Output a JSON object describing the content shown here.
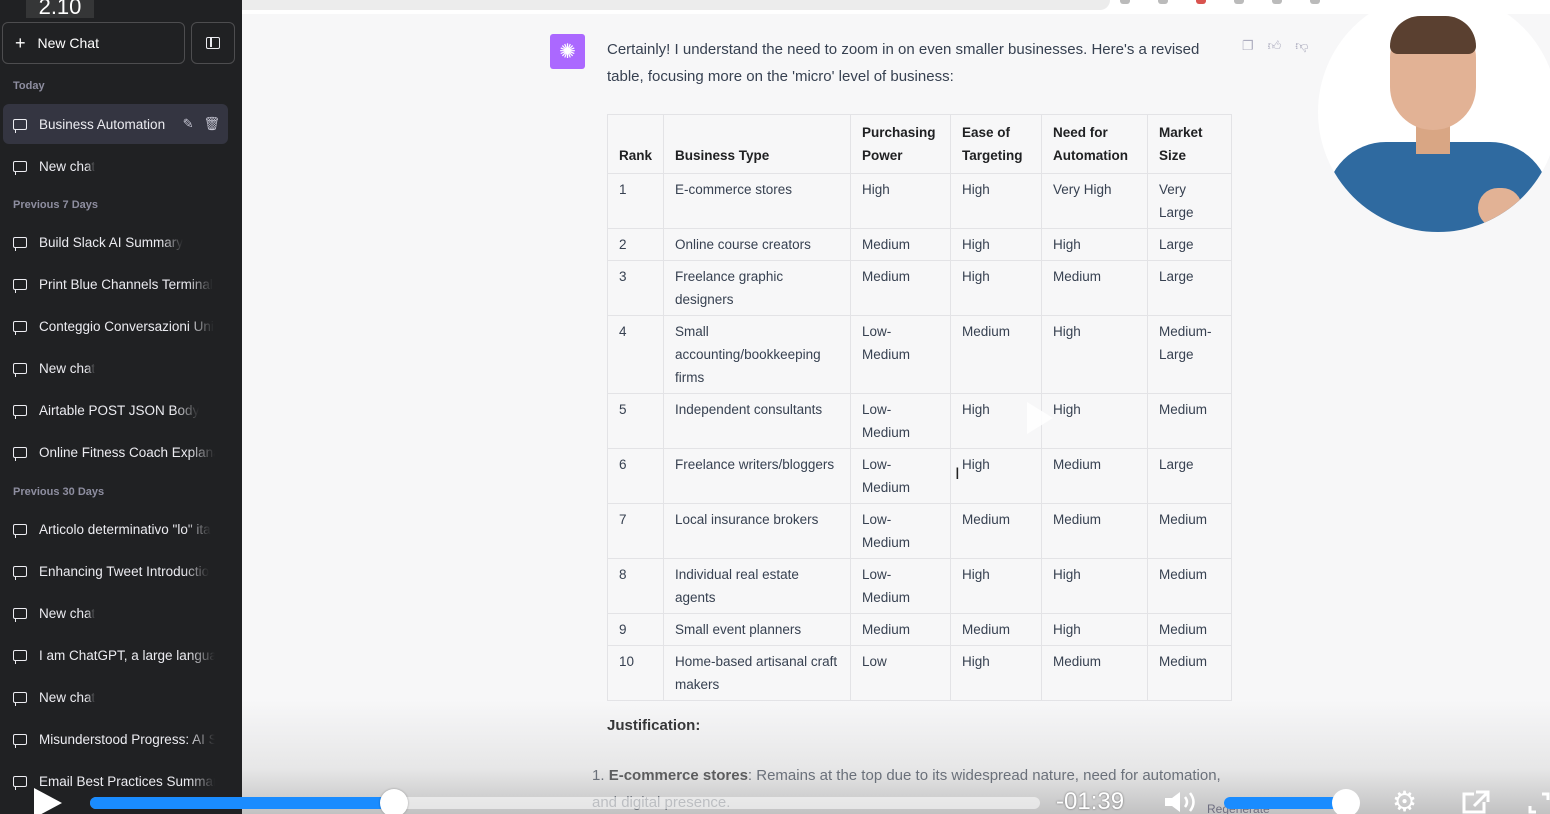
{
  "overlay": {
    "playback_speed": "2.10"
  },
  "sidebar": {
    "new_chat_label": "New Chat",
    "sections": {
      "today": "Today",
      "prev7": "Previous 7 Days",
      "prev30": "Previous 30 Days"
    },
    "items": [
      {
        "label": "Business Automation",
        "active": true
      },
      {
        "label": "New chat"
      },
      {
        "label": "Build Slack AI Summary"
      },
      {
        "label": "Print Blue Channels Terminal"
      },
      {
        "label": "Conteggio Conversazioni Uni"
      },
      {
        "label": "New chat"
      },
      {
        "label": "Airtable POST JSON Body"
      },
      {
        "label": "Online Fitness Coach Explana"
      },
      {
        "label": "Articolo determinativo \"lo\" ita"
      },
      {
        "label": "Enhancing Tweet Introductio"
      },
      {
        "label": "New chat"
      },
      {
        "label": "I am ChatGPT, a large langua"
      },
      {
        "label": "New chat"
      },
      {
        "label": "Misunderstood Progress: AI S"
      },
      {
        "label": "Email Best Practices Summar"
      }
    ]
  },
  "message": {
    "text": "Certainly! I understand the need to zoom in on even smaller businesses. Here's a revised table, focusing more on the 'micro' level of business:"
  },
  "table": {
    "headers": [
      "Rank",
      "Business Type",
      "Purchasing Power",
      "Ease of Targeting",
      "Need for Automation",
      "Market Size"
    ],
    "rows": [
      [
        "1",
        "E-commerce stores",
        "High",
        "High",
        "Very High",
        "Very Large"
      ],
      [
        "2",
        "Online course creators",
        "Medium",
        "High",
        "High",
        "Large"
      ],
      [
        "3",
        "Freelance graphic designers",
        "Medium",
        "High",
        "Medium",
        "Large"
      ],
      [
        "4",
        "Small accounting/bookkeeping firms",
        "Low-Medium",
        "Medium",
        "High",
        "Medium-Large"
      ],
      [
        "5",
        "Independent consultants",
        "Low-Medium",
        "High",
        "High",
        "Medium"
      ],
      [
        "6",
        "Freelance writers/bloggers",
        "Low-Medium",
        "High",
        "Medium",
        "Large"
      ],
      [
        "7",
        "Local insurance brokers",
        "Low-Medium",
        "Medium",
        "Medium",
        "Medium"
      ],
      [
        "8",
        "Individual real estate agents",
        "Low-Medium",
        "High",
        "High",
        "Medium"
      ],
      [
        "9",
        "Small event planners",
        "Medium",
        "Medium",
        "High",
        "Medium"
      ],
      [
        "10",
        "Home-based artisanal craft makers",
        "Low",
        "High",
        "Medium",
        "Medium"
      ]
    ]
  },
  "justification": {
    "title": "Justification:",
    "items": [
      {
        "num": "1.",
        "bold": "E-commerce stores",
        "text": ": Remains at the top due to its widespread nature, need for automation, and digital presence."
      }
    ]
  },
  "footer": {
    "regenerate_label": "Regenerate"
  },
  "video": {
    "time_remaining": "-01:39",
    "progress_fraction": 0.32,
    "volume_fraction": 1.0
  },
  "colors": {
    "accent": "#1a8cff",
    "gpt": "#ab68ff",
    "sidebar": "#202123"
  }
}
